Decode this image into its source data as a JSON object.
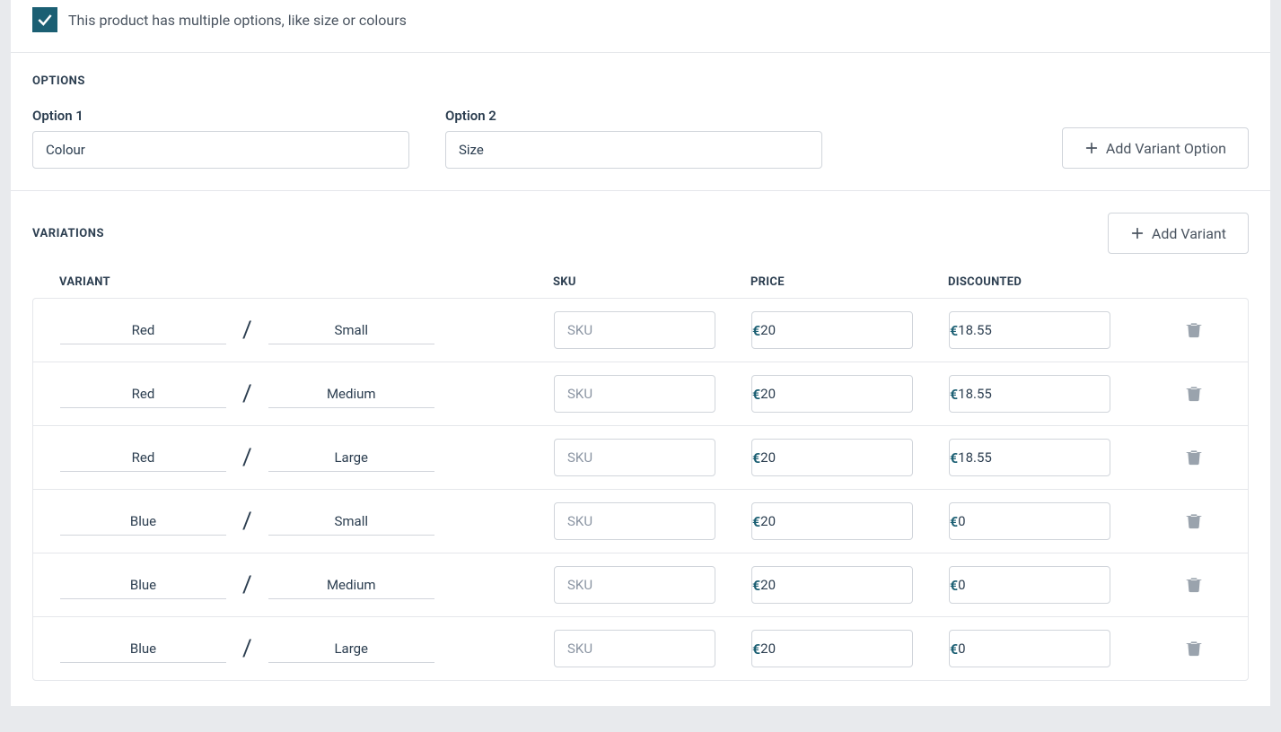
{
  "checkbox": {
    "label": "This product has multiple options, like size or colours",
    "checked": true
  },
  "options": {
    "title": "OPTIONS",
    "items": [
      {
        "label": "Option 1",
        "value": "Colour"
      },
      {
        "label": "Option 2",
        "value": "Size"
      }
    ],
    "add_button_label": "Add Variant Option"
  },
  "variations": {
    "title": "VARIATIONS",
    "add_button_label": "Add Variant",
    "headers": {
      "variant": "VARIANT",
      "sku": "SKU",
      "price": "PRICE",
      "discounted": "DISCOUNTED"
    },
    "currency_symbol": "€",
    "sku_placeholder": "SKU",
    "rows": [
      {
        "opt1": "Red",
        "opt2": "Small",
        "sku": "",
        "price": "20",
        "discounted": "18.55"
      },
      {
        "opt1": "Red",
        "opt2": "Medium",
        "sku": "",
        "price": "20",
        "discounted": "18.55"
      },
      {
        "opt1": "Red",
        "opt2": "Large",
        "sku": "",
        "price": "20",
        "discounted": "18.55"
      },
      {
        "opt1": "Blue",
        "opt2": "Small",
        "sku": "",
        "price": "20",
        "discounted": "0"
      },
      {
        "opt1": "Blue",
        "opt2": "Medium",
        "sku": "",
        "price": "20",
        "discounted": "0"
      },
      {
        "opt1": "Blue",
        "opt2": "Large",
        "sku": "",
        "price": "20",
        "discounted": "0"
      }
    ]
  }
}
